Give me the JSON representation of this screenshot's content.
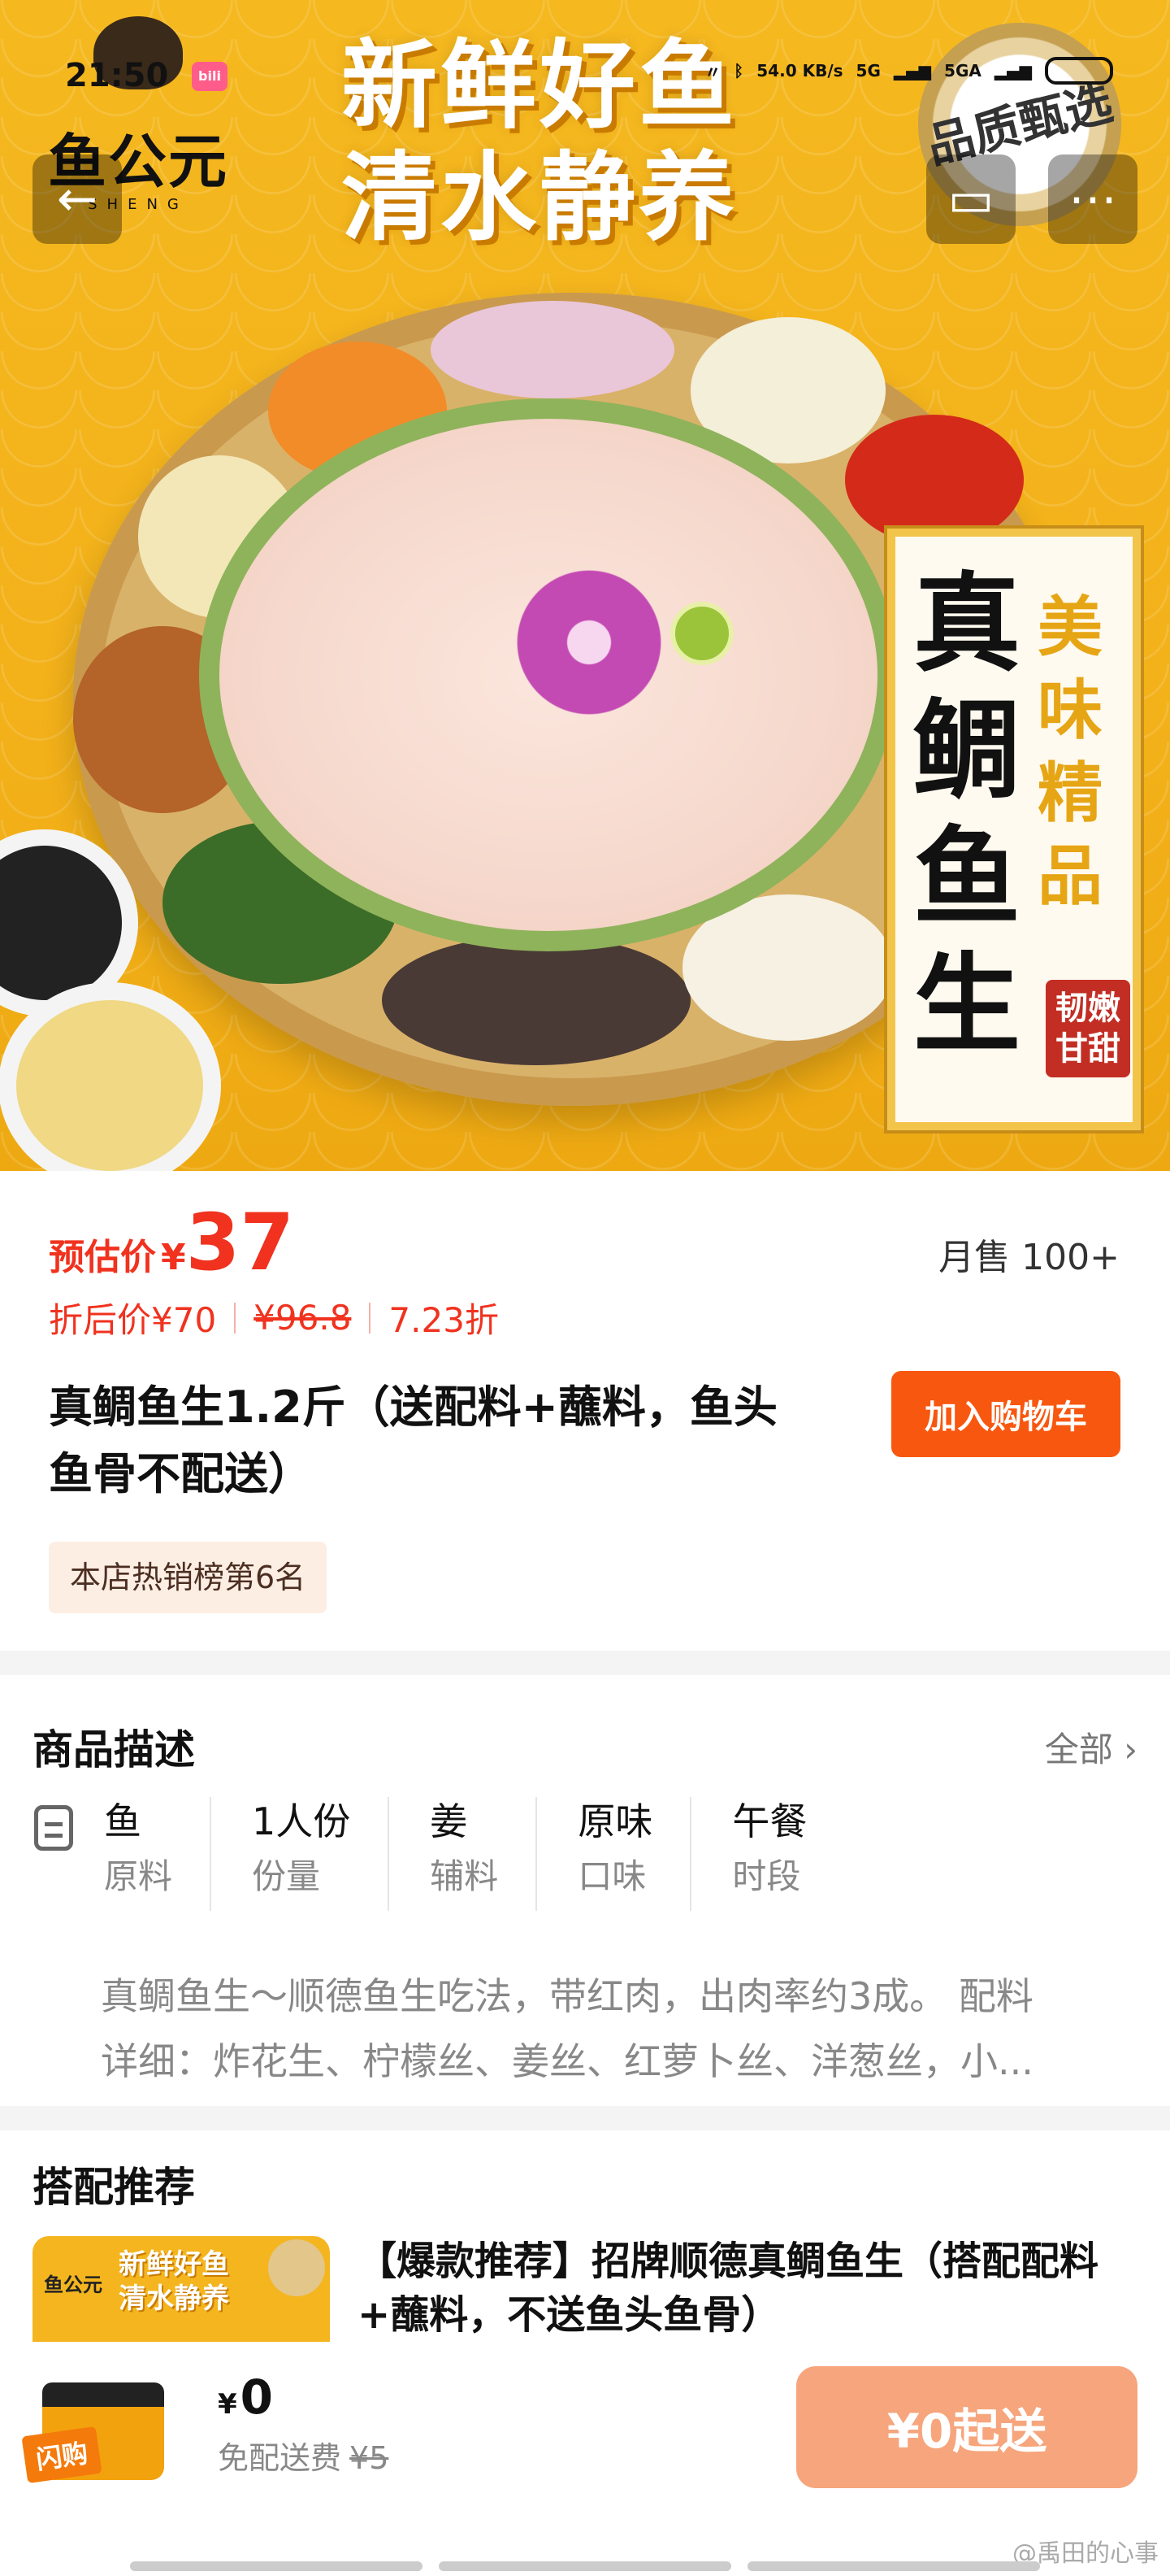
{
  "status_bar": {
    "time": "21:50",
    "app_badge": "bilibili",
    "speed": "54.0 KB/s",
    "network1": "5G",
    "network2": "5GA"
  },
  "hero": {
    "brand_name": "鱼公元",
    "brand_sub": "SHENG",
    "slogan_line1": "新鲜好鱼",
    "slogan_line2": "清水静养",
    "seal_text": "品质甄选",
    "badge_big": "真鲷鱼生",
    "badge_small": "美味精品",
    "badge_stamp": "韧嫩甘甜"
  },
  "product": {
    "price_label": "预估价",
    "price_currency": "¥",
    "price_value": "37",
    "monthly_sales": "月售 100+",
    "discount_price": "折后价¥70",
    "original_price": "¥96.8",
    "discount_rate": "7.23折",
    "title": "真鲷鱼生1.2斤（送配料+蘸料，鱼头鱼骨不配送）",
    "add_to_cart": "加入购物车",
    "rank": "本店热销榜第6名"
  },
  "description": {
    "title": "商品描述",
    "all_link": "全部 ›",
    "attributes": [
      {
        "value": "鱼",
        "key": "原料"
      },
      {
        "value": "1人份",
        "key": "份量"
      },
      {
        "value": "姜",
        "key": "辅料"
      },
      {
        "value": "原味",
        "key": "口味"
      },
      {
        "value": "午餐",
        "key": "时段"
      }
    ],
    "text_line1": "真鲷鱼生～顺德鱼生吃法，带红肉，出肉率约3成。 配料",
    "text_line2": "详细：炸花生、柠檬丝、姜丝、红萝卜丝、洋葱丝，小..."
  },
  "recommend": {
    "title": "搭配推荐",
    "thumb_slogan1": "新鲜好鱼",
    "thumb_slogan2": "清水静养",
    "thumb_brand": "鱼公元",
    "item_title": "【爆款推荐】招牌顺德真鲷鱼生（搭配配料+蘸料，不送鱼头鱼骨）"
  },
  "bottom_bar": {
    "bag_label": "闪购",
    "fee_currency": "¥",
    "fee_value": "0",
    "free_delivery": "免配送费",
    "old_fee": "¥5",
    "start_button": "¥0起送"
  },
  "watermark": "@禹田的心事"
}
